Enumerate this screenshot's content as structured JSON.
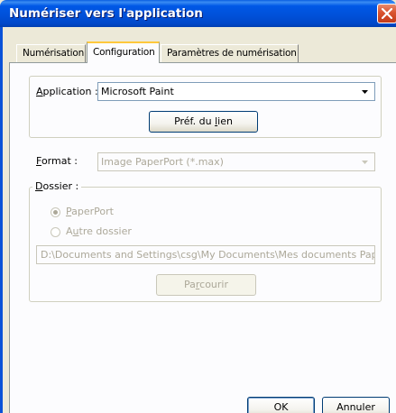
{
  "window": {
    "title": "Numériser vers l'application"
  },
  "tabs": [
    {
      "label": "Numérisation",
      "active": false
    },
    {
      "label": "Configuration",
      "active": true
    },
    {
      "label": "Paramètres de numérisation",
      "active": false
    }
  ],
  "application": {
    "label_underlined": "A",
    "label_rest": "pplication :",
    "value": "Microsoft Paint",
    "link_prefs_button_pre": "Préf. du ",
    "link_prefs_button_underlined": "l",
    "link_prefs_button_post": "ien"
  },
  "format": {
    "label_underlined": "F",
    "label_rest": "ormat :",
    "value": "Image PaperPort (*.max)"
  },
  "folder": {
    "label_underlined": "D",
    "label_rest": "ossier :",
    "radio_paperport_underlined": "P",
    "radio_paperport_rest": "aperPort",
    "radio_paperport_selected": true,
    "radio_other_pre": "A",
    "radio_other_underlined": "u",
    "radio_other_post": "tre dossier",
    "radio_other_selected": false,
    "path": "D:\\Documents and Settings\\csg\\My Documents\\Mes documents Paper",
    "browse_pre": "Pa",
    "browse_underlined": "r",
    "browse_post": "courir"
  },
  "footer": {
    "ok_label": "OK",
    "cancel_label": "Annuler"
  },
  "icons": {
    "close": "close-icon",
    "dropdown": "chevron-down-icon"
  },
  "colors": {
    "titlebar": "#0058e6",
    "panel": "#fcfcfe",
    "dialog": "#ece9d8",
    "disabled_text": "#aca899",
    "close_button": "#d9532f"
  }
}
